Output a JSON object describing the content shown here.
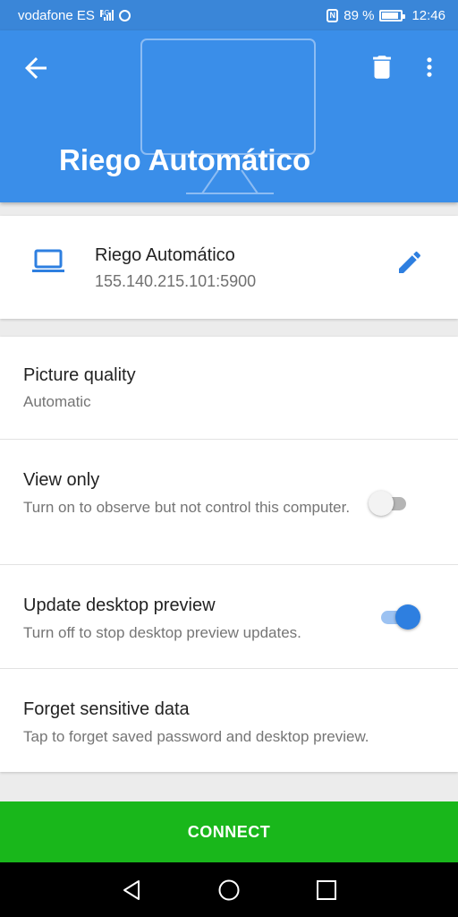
{
  "status_bar": {
    "carrier": "vodafone ES",
    "network_tag": "4G",
    "battery_text": "89 %",
    "battery_level": 0.89,
    "time": "12:46"
  },
  "app_bar": {
    "title": "Riego Automático",
    "color": "#3a8ee9",
    "icons": [
      "back-arrow-icon",
      "delete-icon",
      "more-vert-icon",
      "monitor-icon"
    ]
  },
  "host": {
    "name": "Riego Automático",
    "address": "155.140.215.101:5900",
    "icons": [
      "laptop-icon",
      "edit-pencil-icon"
    ],
    "accent": "#2e7fe0"
  },
  "settings": {
    "picture_quality": {
      "title": "Picture quality",
      "value": "Automatic"
    },
    "view_only": {
      "title": "View only",
      "description": "Turn on to observe but not control this computer.",
      "enabled": false
    },
    "desktop_preview": {
      "title": "Update desktop preview",
      "description": "Turn off to stop desktop preview updates.",
      "enabled": true
    },
    "forget_data": {
      "title": "Forget sensitive data",
      "description": "Tap to forget saved password and desktop preview."
    }
  },
  "connect_button": {
    "label": "CONNECT",
    "color": "#19b71b"
  },
  "nav_bar": {
    "icons": [
      "nav-back-icon",
      "nav-home-icon",
      "nav-recents-icon"
    ]
  }
}
